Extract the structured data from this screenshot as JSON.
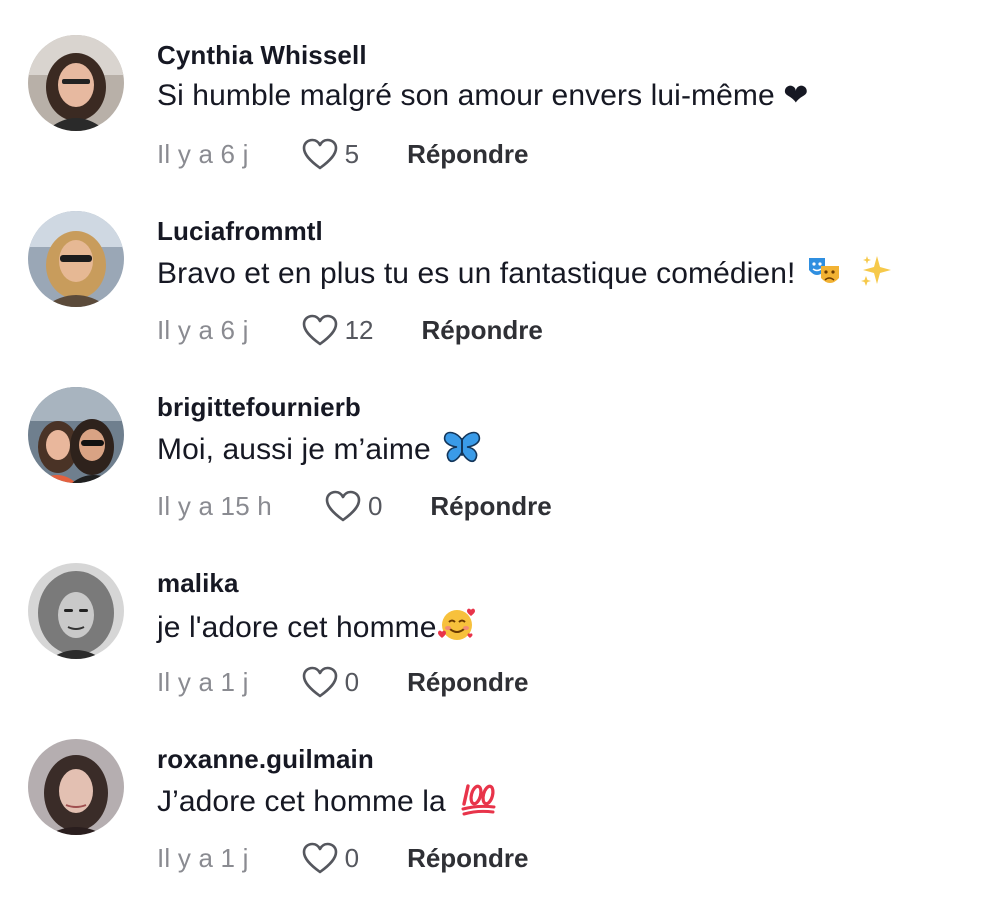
{
  "comments": [
    {
      "username": "Cynthia Whissell",
      "text": "Si humble malgré son amour envers lui-même ❤",
      "time": "Il y a 6 j",
      "likes": "5",
      "reply_label": "Répondre",
      "emojis": []
    },
    {
      "username": "Luciafrommtl",
      "text": "Bravo et en plus tu es un fantastique comédien!",
      "time": "Il y a 6 j",
      "likes": "12",
      "reply_label": "Répondre",
      "emojis": [
        "performing-arts-icon",
        "sparkles-icon"
      ]
    },
    {
      "username": "brigittefournierb",
      "text": "Moi, aussi je m’aime",
      "time": "Il y a 15 h",
      "likes": "0",
      "reply_label": "Répondre",
      "emojis": [
        "butterfly-icon"
      ]
    },
    {
      "username": "malika",
      "text": "je l'adore cet homme",
      "time": "Il y a 1 j",
      "likes": "0",
      "reply_label": "Répondre",
      "emojis": [
        "smiling-face-with-hearts-icon"
      ]
    },
    {
      "username": "roxanne.guilmain",
      "text": "J’adore cet homme la",
      "time": "Il y a 1 j",
      "likes": "0",
      "reply_label": "Répondre",
      "emojis": [
        "hundred-points-icon"
      ]
    }
  ],
  "colors": {
    "username": "#161823",
    "text": "#161823",
    "time": "#8a8b91",
    "reply": "#2f3035",
    "heart_outline": "#55575e"
  }
}
